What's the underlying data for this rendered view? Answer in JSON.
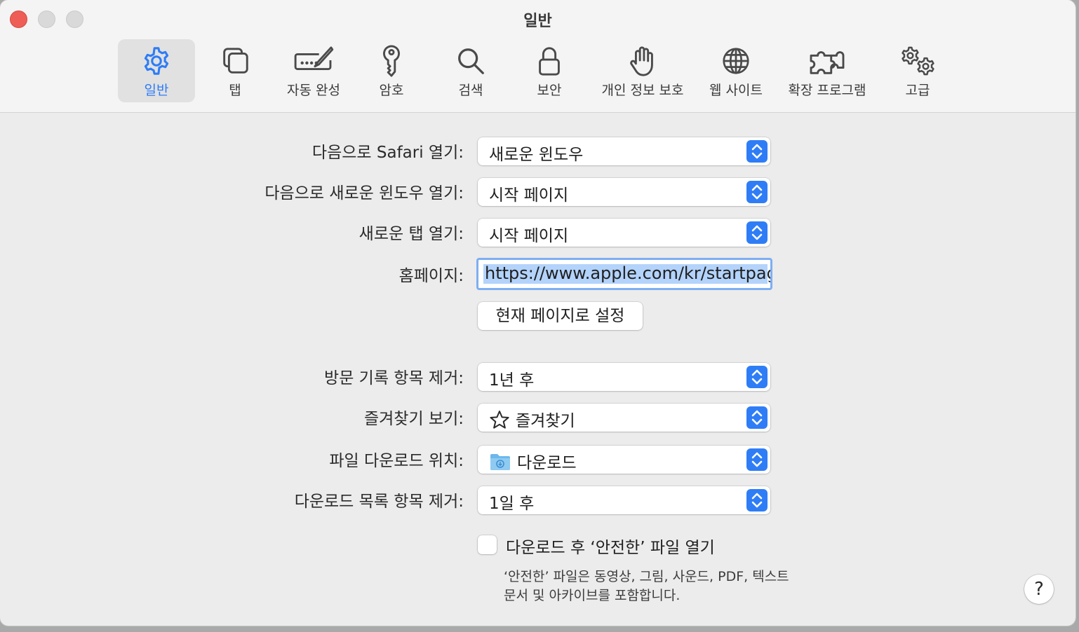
{
  "window": {
    "title": "일반"
  },
  "tabs": [
    {
      "id": "general",
      "label": "일반",
      "icon": "gear-icon",
      "active": true
    },
    {
      "id": "tabs",
      "label": "탭",
      "icon": "tabs-icon",
      "active": false
    },
    {
      "id": "autofill",
      "label": "자동 완성",
      "icon": "pencil-field-icon",
      "active": false
    },
    {
      "id": "passwords",
      "label": "암호",
      "icon": "key-icon",
      "active": false
    },
    {
      "id": "search",
      "label": "검색",
      "icon": "magnifier-icon",
      "active": false
    },
    {
      "id": "security",
      "label": "보안",
      "icon": "lock-icon",
      "active": false
    },
    {
      "id": "privacy",
      "label": "개인 정보 보호",
      "icon": "hand-icon",
      "active": false
    },
    {
      "id": "websites",
      "label": "웹 사이트",
      "icon": "globe-icon",
      "active": false
    },
    {
      "id": "extensions",
      "label": "확장 프로그램",
      "icon": "puzzle-icon",
      "active": false
    },
    {
      "id": "advanced",
      "label": "고급",
      "icon": "gears-icon",
      "active": false
    }
  ],
  "settings": {
    "open_safari_with": {
      "label": "다음으로 Safari 열기:",
      "value": "새로운 윈도우"
    },
    "new_windows_open_with": {
      "label": "다음으로 새로운 윈도우 열기:",
      "value": "시작 페이지"
    },
    "new_tabs_open_with": {
      "label": "새로운 탭 열기:",
      "value": "시작 페이지"
    },
    "homepage": {
      "label": "홈페이지:",
      "value": "https://www.apple.com/kr/startpage/"
    },
    "set_current_page_button": "현재 페이지로 설정",
    "remove_history_items": {
      "label": "방문 기록 항목 제거:",
      "value": "1년 후"
    },
    "favorites_shows": {
      "label": "즐겨찾기 보기:",
      "value": "즐겨찾기",
      "icon": "star-icon"
    },
    "download_location": {
      "label": "파일 다운로드 위치:",
      "value": "다운로드",
      "icon": "downloads-folder-icon"
    },
    "remove_download_items": {
      "label": "다운로드 목록 항목 제거:",
      "value": "1일 후"
    },
    "open_safe_files": {
      "label": "다운로드 후 ‘안전한’ 파일 열기",
      "checked": false,
      "note_line1": "‘안전한’ 파일은 동영상, 그림, 사운드, PDF, 텍스트",
      "note_line2": "문서 및 아카이브를 포함합니다."
    }
  },
  "help_button": "?",
  "colors": {
    "accent": "#2f7df6",
    "close": "#ee5e57",
    "selection": "#b3d3fb"
  }
}
